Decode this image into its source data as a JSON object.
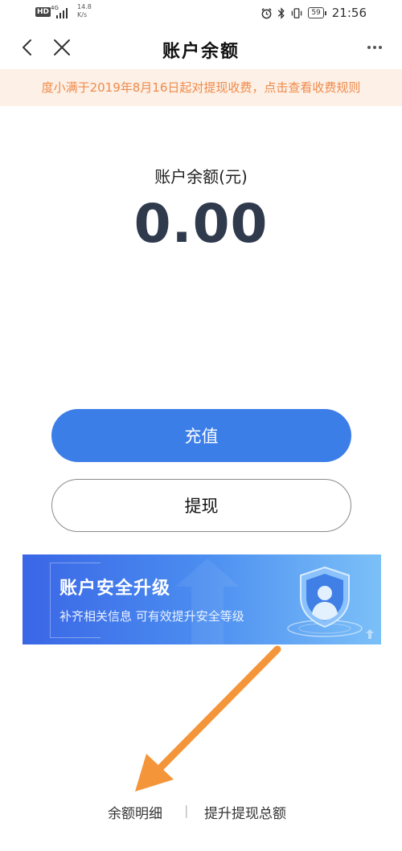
{
  "status_bar": {
    "hd": "HD",
    "network": "4G",
    "speed_value": "14.8",
    "speed_unit": "K/s",
    "battery": "59",
    "time": "21:56"
  },
  "nav": {
    "title": "账户余额"
  },
  "notice": {
    "text": "度小满于2019年8月16日起对提现收费，点击查看收费规则"
  },
  "balance": {
    "label": "账户余额(元)",
    "value": "0.00"
  },
  "actions": {
    "recharge_label": "充值",
    "withdraw_label": "提现"
  },
  "banner": {
    "title": "账户安全升级",
    "subtitle": "补齐相关信息 可有效提升安全等级"
  },
  "footer": {
    "detail_link": "余额明细",
    "separator": "|",
    "raise_link": "提升提现总额"
  },
  "colors": {
    "primary": "#3c7ee8",
    "notice_bg": "#fdf0e6",
    "notice_text": "#ef8a4a",
    "balance_text": "#2f3a4d",
    "annotation_arrow": "#f5953a"
  }
}
